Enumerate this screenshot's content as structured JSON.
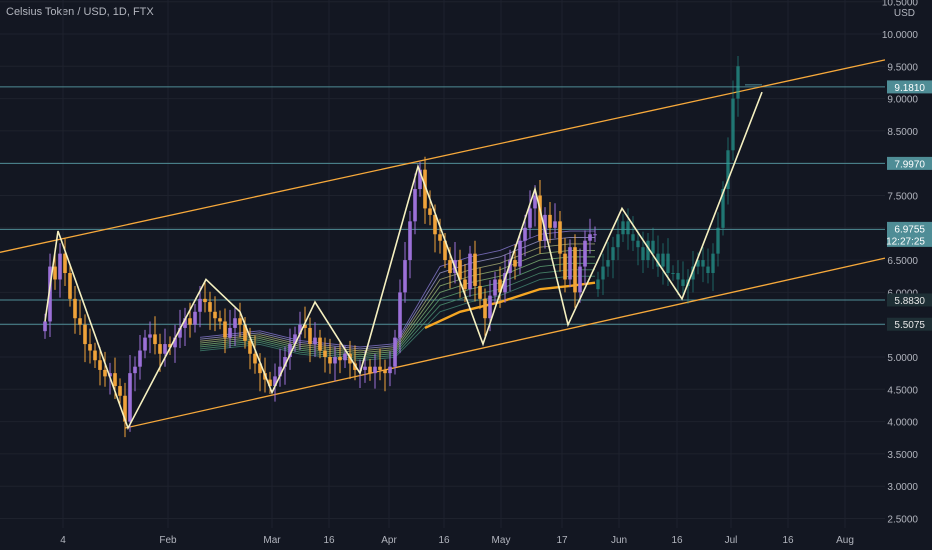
{
  "header": {
    "title": "Celsius Token / USD, 1D, FTX"
  },
  "chart_data": {
    "type": "candlestick",
    "currency": "USD",
    "y_axis": {
      "ylim": [
        2.4,
        10.65
      ],
      "ticks": [
        "10.5000",
        "10.0000",
        "9.5000",
        "9.0000",
        "8.5000",
        "7.5000",
        "7.0000",
        "6.5000",
        "6.0000",
        "5.5000",
        "5.0000",
        "4.5000",
        "4.0000",
        "3.5000",
        "3.0000",
        "2.5000"
      ]
    },
    "x_axis": {
      "ticks": [
        "4",
        "Feb",
        "Mar",
        "16",
        "Apr",
        "16",
        "May",
        "17",
        "Jun",
        "16",
        "Jul",
        "16",
        "Aug"
      ]
    },
    "price_labels": [
      {
        "text": "9.1810",
        "value": 9.181,
        "color": "#4f8d96"
      },
      {
        "text": "7.9970",
        "value": 7.997,
        "color": "#4f8d96"
      },
      {
        "text": "6.9755",
        "value": 6.9755,
        "color": "#4f8d96"
      },
      {
        "text": "12:27:25",
        "value": 6.9755,
        "color": "#4f8d96"
      },
      {
        "text": "5.8830",
        "value": 5.883,
        "color": "#4f8d96"
      },
      {
        "text": "5.5075",
        "value": 5.5075,
        "color": "#4f8d96"
      }
    ],
    "horizontal_levels": [
      9.181,
      7.997,
      6.9755,
      5.883,
      5.5075
    ],
    "channel": {
      "upper": [
        [
          0,
          6.62
        ],
        [
          885,
          9.6
        ]
      ],
      "lower": [
        [
          125,
          3.9
        ],
        [
          885,
          6.53
        ]
      ],
      "color": "#f7a93b"
    },
    "zigzag": [
      [
        45,
        5.55
      ],
      [
        58,
        6.95
      ],
      [
        128,
        3.9
      ],
      [
        206,
        6.2
      ],
      [
        240,
        5.7
      ],
      [
        272,
        4.45
      ],
      [
        315,
        5.85
      ],
      [
        360,
        4.75
      ],
      [
        418,
        7.95
      ],
      [
        483,
        5.2
      ],
      [
        535,
        7.6
      ],
      [
        568,
        5.5
      ],
      [
        622,
        7.3
      ],
      [
        682,
        5.9
      ],
      [
        762,
        9.1
      ]
    ],
    "zigzag_projection_start_x": 595,
    "closes": [
      [
        45,
        5.55
      ],
      [
        50,
        6.4
      ],
      [
        55,
        6.2
      ],
      [
        60,
        6.6
      ],
      [
        65,
        6.3
      ],
      [
        70,
        5.9
      ],
      [
        75,
        5.6
      ],
      [
        80,
        5.5
      ],
      [
        85,
        5.2
      ],
      [
        90,
        5.1
      ],
      [
        95,
        4.95
      ],
      [
        100,
        4.8
      ],
      [
        105,
        4.7
      ],
      [
        110,
        4.75
      ],
      [
        115,
        4.55
      ],
      [
        120,
        4.4
      ],
      [
        125,
        4.0
      ],
      [
        130,
        4.75
      ],
      [
        135,
        4.85
      ],
      [
        140,
        5.1
      ],
      [
        145,
        5.3
      ],
      [
        150,
        5.35
      ],
      [
        155,
        5.2
      ],
      [
        160,
        5.05
      ],
      [
        165,
        5.2
      ],
      [
        170,
        5.15
      ],
      [
        175,
        5.3
      ],
      [
        180,
        5.45
      ],
      [
        185,
        5.6
      ],
      [
        190,
        5.5
      ],
      [
        195,
        5.7
      ],
      [
        200,
        5.9
      ],
      [
        205,
        5.85
      ],
      [
        210,
        5.7
      ],
      [
        215,
        5.6
      ],
      [
        220,
        5.55
      ],
      [
        225,
        5.3
      ],
      [
        230,
        5.45
      ],
      [
        235,
        5.6
      ],
      [
        240,
        5.5
      ],
      [
        245,
        5.25
      ],
      [
        250,
        5.05
      ],
      [
        255,
        4.9
      ],
      [
        260,
        4.75
      ],
      [
        265,
        4.65
      ],
      [
        270,
        4.55
      ],
      [
        275,
        4.7
      ],
      [
        280,
        4.85
      ],
      [
        285,
        5.0
      ],
      [
        290,
        5.2
      ],
      [
        295,
        5.35
      ],
      [
        300,
        5.5
      ],
      [
        305,
        5.45
      ],
      [
        310,
        5.2
      ],
      [
        315,
        5.3
      ],
      [
        320,
        5.1
      ],
      [
        325,
        5.0
      ],
      [
        330,
        4.9
      ],
      [
        335,
        5.0
      ],
      [
        340,
        4.95
      ],
      [
        345,
        5.05
      ],
      [
        350,
        4.9
      ],
      [
        355,
        4.8
      ],
      [
        360,
        4.8
      ],
      [
        365,
        4.85
      ],
      [
        370,
        4.75
      ],
      [
        375,
        4.85
      ],
      [
        380,
        4.8
      ],
      [
        385,
        4.75
      ],
      [
        390,
        4.85
      ],
      [
        395,
        5.3
      ],
      [
        400,
        6.0
      ],
      [
        405,
        6.5
      ],
      [
        410,
        7.1
      ],
      [
        415,
        7.6
      ],
      [
        420,
        7.9
      ],
      [
        425,
        7.3
      ],
      [
        430,
        7.2
      ],
      [
        435,
        6.9
      ],
      [
        440,
        6.8
      ],
      [
        445,
        6.5
      ],
      [
        450,
        6.3
      ],
      [
        455,
        6.5
      ],
      [
        460,
        6.2
      ],
      [
        465,
        6.05
      ],
      [
        470,
        6.6
      ],
      [
        475,
        6.1
      ],
      [
        480,
        5.9
      ],
      [
        485,
        5.6
      ],
      [
        490,
        5.95
      ],
      [
        495,
        6.2
      ],
      [
        500,
        6.0
      ],
      [
        505,
        6.3
      ],
      [
        510,
        6.5
      ],
      [
        515,
        6.4
      ],
      [
        520,
        6.8
      ],
      [
        525,
        7.0
      ],
      [
        530,
        7.3
      ],
      [
        535,
        7.5
      ],
      [
        540,
        6.8
      ],
      [
        545,
        7.2
      ],
      [
        550,
        7.0
      ],
      [
        555,
        7.1
      ],
      [
        560,
        6.6
      ],
      [
        565,
        6.2
      ],
      [
        570,
        6.7
      ],
      [
        575,
        6.0
      ],
      [
        580,
        6.4
      ],
      [
        585,
        6.8
      ],
      [
        590,
        6.9
      ],
      [
        595,
        6.9
      ]
    ],
    "projection_closes": [
      [
        598,
        6.2
      ],
      [
        603,
        6.4
      ],
      [
        608,
        6.5
      ],
      [
        613,
        6.7
      ],
      [
        618,
        6.9
      ],
      [
        623,
        7.1
      ],
      [
        628,
        6.9
      ],
      [
        633,
        6.8
      ],
      [
        638,
        6.7
      ],
      [
        643,
        6.5
      ],
      [
        648,
        6.8
      ],
      [
        653,
        6.6
      ],
      [
        658,
        6.4
      ],
      [
        663,
        6.6
      ],
      [
        668,
        6.3
      ],
      [
        673,
        6.3
      ],
      [
        678,
        6.2
      ],
      [
        683,
        6.1
      ],
      [
        688,
        6.2
      ],
      [
        693,
        6.4
      ],
      [
        698,
        6.5
      ],
      [
        703,
        6.4
      ],
      [
        708,
        6.3
      ],
      [
        713,
        6.6
      ],
      [
        718,
        7.0
      ],
      [
        723,
        7.6
      ],
      [
        728,
        8.2
      ],
      [
        733,
        9.0
      ],
      [
        738,
        9.5
      ]
    ],
    "ma": {
      "main": [
        [
          425,
          5.45
        ],
        [
          460,
          5.7
        ],
        [
          500,
          5.85
        ],
        [
          540,
          6.05
        ],
        [
          570,
          6.1
        ],
        [
          595,
          6.15
        ]
      ],
      "ribbon": [
        [
          200,
          5.2
        ],
        [
          260,
          5.3
        ],
        [
          300,
          5.15
        ],
        [
          360,
          5.05
        ],
        [
          395,
          5.1
        ],
        [
          440,
          6.05
        ],
        [
          470,
          6.2
        ],
        [
          500,
          6.3
        ],
        [
          540,
          6.55
        ],
        [
          570,
          6.6
        ],
        [
          595,
          6.6
        ]
      ],
      "ribbon_offsets": [
        -0.35,
        -0.25,
        -0.15,
        -0.05,
        0.05,
        0.15,
        0.25,
        0.35
      ]
    }
  }
}
